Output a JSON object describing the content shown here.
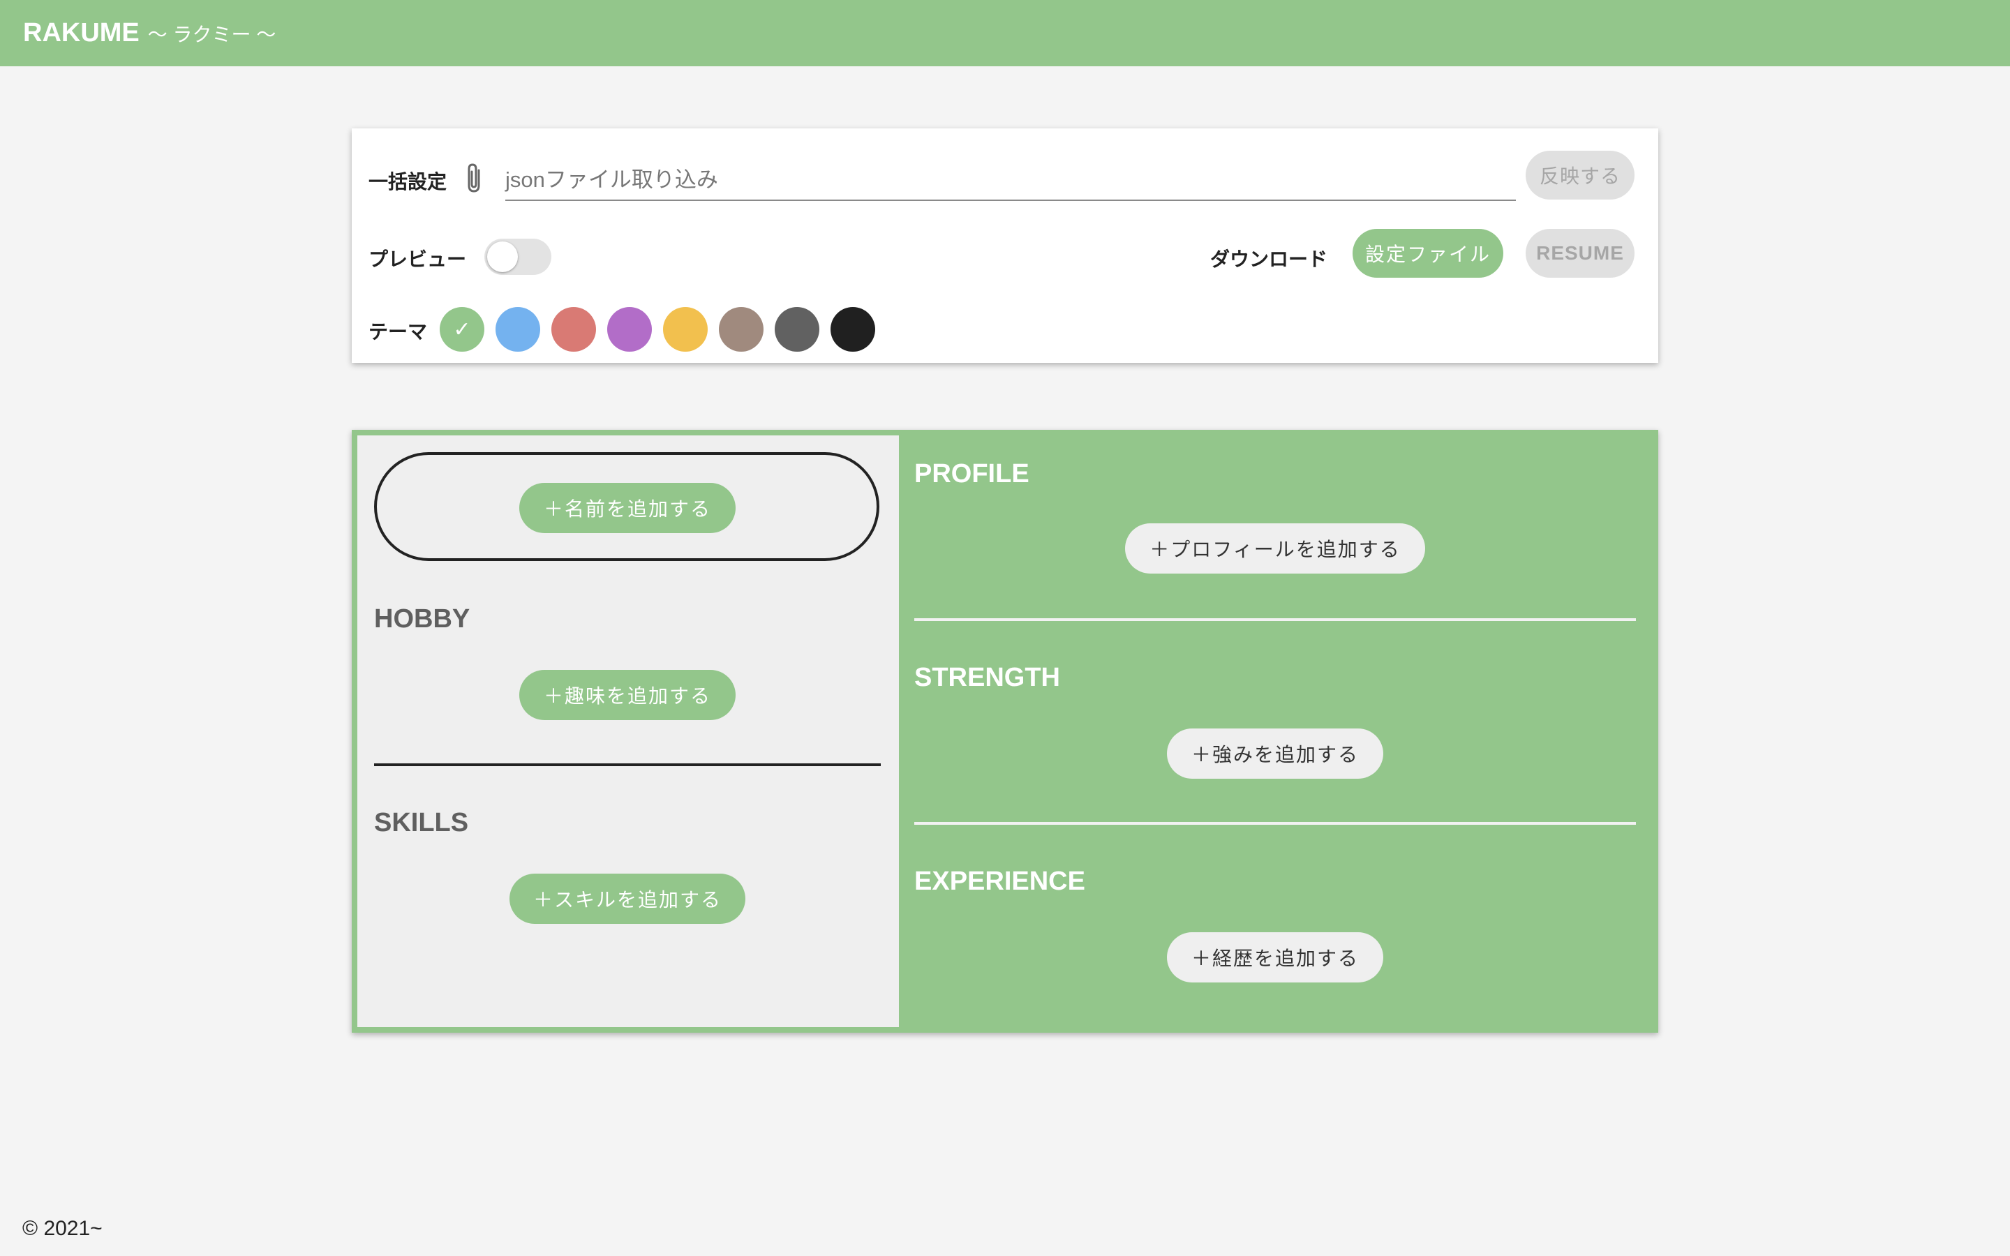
{
  "app": {
    "title": "RAKUME",
    "subtitle": "〜 ラクミー 〜"
  },
  "settings": {
    "bulk_label": "一括設定",
    "json_placeholder": "jsonファイル取り込み",
    "apply_label": "反映する",
    "preview_label": "プレビュー",
    "preview_on": false,
    "download_label": "ダウンロード",
    "settings_file_label": "設定ファイル",
    "resume_label": "RESUME",
    "theme_label": "テーマ",
    "themes": [
      "#93c68b",
      "#74b2ef",
      "#d97a74",
      "#b26dc8",
      "#f2c04e",
      "#a08a7e",
      "#616161",
      "#202020"
    ],
    "selected_theme": "#93c68b",
    "check_glyph": "✓"
  },
  "resume": {
    "add_name": "＋名前を追加する",
    "hobby_title": "HOBBY",
    "add_hobby": "＋趣味を追加する",
    "skills_title": "SKILLS",
    "add_skill": "＋スキルを追加する",
    "profile_title": "PROFILE",
    "add_profile": "＋プロフィールを追加する",
    "strength_title": "STRENGTH",
    "add_strength": "＋強みを追加する",
    "experience_title": "EXPERIENCE",
    "add_experience": "＋経歴を追加する"
  },
  "footer": {
    "copyright": "© 2021~"
  }
}
